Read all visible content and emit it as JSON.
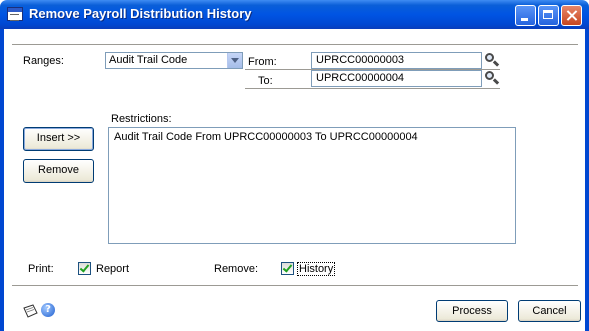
{
  "window": {
    "title": "Remove Payroll Distribution History"
  },
  "ranges": {
    "label": "Ranges:",
    "selected": "Audit Trail Code",
    "from_label": "From:",
    "from_value": "UPRCC00000003",
    "to_label": "To:",
    "to_value": "UPRCC00000004"
  },
  "restrictions": {
    "label": "Restrictions:",
    "items": [
      "Audit Trail Code From UPRCC00000003 To UPRCC00000004"
    ]
  },
  "buttons": {
    "insert": "Insert >>",
    "remove": "Remove",
    "process": "Process",
    "cancel": "Cancel"
  },
  "options": {
    "print_label": "Print:",
    "report_label": "Report",
    "report_checked": true,
    "remove_label": "Remove:",
    "history_label": "History",
    "history_checked": true
  },
  "icons": {
    "note": "note-icon",
    "help": "help-icon"
  }
}
